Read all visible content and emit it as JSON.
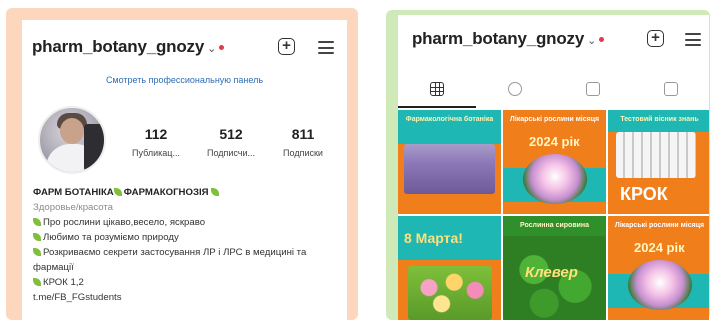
{
  "left_panel": {
    "username": "pharm_botany_gnozy",
    "dropdown_glyph": "⌄",
    "pro_dashboard_link": "Смотреть профессиональную панель",
    "stats": [
      {
        "value": "112",
        "label": "Публикац..."
      },
      {
        "value": "512",
        "label": "Подписчи..."
      },
      {
        "value": "811",
        "label": "Подписки"
      }
    ],
    "bio": {
      "name_part1": "ФАРМ БОТАНІКА",
      "name_part2": "ФАРМАКОГНОЗІЯ",
      "category": "Здоровье/красота",
      "lines": [
        "Про рослини цікаво,весело, яскраво",
        "Любимо та розуміємо природу",
        "Розкриваємо секрети застосування ЛР і ЛРС в медицині та фармації",
        "КРОК 1,2"
      ],
      "link": "t.me/FB_FGstudents"
    }
  },
  "right_panel": {
    "username": "pharm_botany_gnozy",
    "dropdown_glyph": "⌄",
    "tabs": [
      "grid-icon",
      "reels-icon",
      "guides-icon",
      "tagged-icon"
    ],
    "posts": [
      {
        "heading": "Фармакологічна ботаніка",
        "type": "lavender-field"
      },
      {
        "heading": "Лікарські рослини місяця",
        "year": "2024 рік",
        "type": "water-lily"
      },
      {
        "heading": "Тестовий вісник знань",
        "big": "КРОК",
        "type": "answer-sheet"
      },
      {
        "big": "8 Марта!",
        "type": "tulips"
      },
      {
        "heading": "Рослинна сировина",
        "big": "Клевер",
        "type": "clover"
      },
      {
        "heading": "Лікарські рослини місяця",
        "year": "2024 рік",
        "type": "water-lily"
      }
    ]
  },
  "colors": {
    "left_frame": "#fcd7bd",
    "right_frame": "#cfeab8",
    "tile_orange": "#f07e1b",
    "tile_teal": "#1eb7b4",
    "link_blue": "#2f6db3",
    "notification_red": "#e5374f"
  }
}
